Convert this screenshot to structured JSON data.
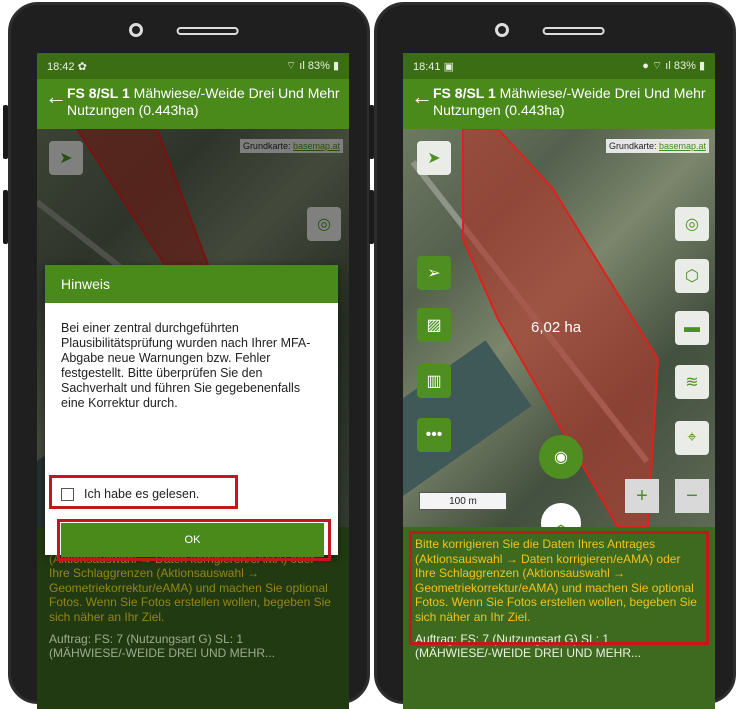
{
  "left_screen": {
    "status": {
      "time": "18:42",
      "battery": "83%",
      "settings_icon": "gear-icon"
    },
    "appbar": {
      "bold": "FS 8/SL 1",
      "title": " Mähwiese/-Weide Drei Und Mehr Nutzungen (0.443ha)"
    },
    "basemap_prefix": "Grundkarte: ",
    "basemap_link": "basemap.at",
    "dialog": {
      "title": "Hinweis",
      "body": "Bei einer zentral durchgeführten Plausibilitätsprüfung wurden nach Ihrer MFA-Abgabe neue Warnungen bzw. Fehler festgestellt. Bitte überprüfen Sie den Sachverhalt und führen Sie gegebenenfalls eine Korrektur durch.",
      "checkbox_label": "Ich habe es gelesen.",
      "ok_label": "OK"
    },
    "info_text": "Bitte korrigieren Sie die Daten Ihres Antrages (Aktionsauswahl → Daten korrigieren/eAMA) oder Ihre Schlaggrenzen (Aktionsauswahl → Geometriekorrektur/eAMA) und machen Sie optional Fotos. Wenn Sie Fotos erstellen wollen, begeben Sie sich näher an Ihr Ziel.",
    "auftrag_line1": "Auftrag: FS: 7 (Nutzungsart G) SL: 1",
    "auftrag_line2": "(MÄHWIESE/-WEIDE DREI UND MEHR..."
  },
  "right_screen": {
    "status": {
      "time": "18:41",
      "battery": "83%"
    },
    "appbar": {
      "bold": "FS 8/SL 1",
      "title": " Mähwiese/-Weide Drei Und Mehr Nutzungen (0.443ha)"
    },
    "basemap_prefix": "Grundkarte: ",
    "basemap_link": "basemap.at",
    "area_label": "6,02 ha",
    "scale_label": "100 m",
    "zoom_in": "+",
    "zoom_out": "−",
    "info_text": "Bitte korrigieren Sie die Daten Ihres Antrages (Aktionsauswahl → Daten korrigieren/eAMA) oder Ihre Schlaggrenzen (Aktionsauswahl → Geometriekorrektur/eAMA) und machen Sie optional Fotos. Wenn Sie Fotos erstellen wollen, begeben Sie sich näher an Ihr Ziel.",
    "auftrag_line1": "Auftrag: FS: 7 (Nutzungsart G) SL: 1",
    "auftrag_line2": "(MÄHWIESE/-WEIDE DREI UND MEHR..."
  },
  "colors": {
    "appbar": "#4a8a1a",
    "highlight": "#c4161c",
    "info_text": "#f0c21e",
    "parcel_fill": "#c0392b"
  }
}
